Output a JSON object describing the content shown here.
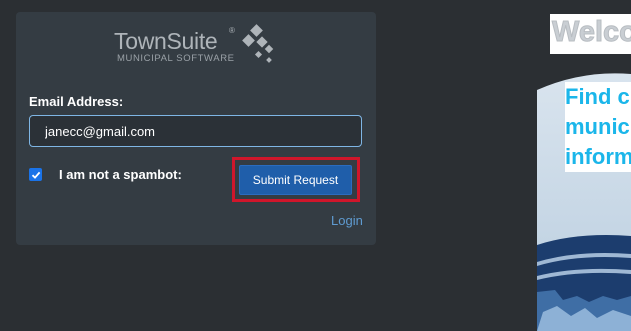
{
  "brand": {
    "name": "TownSuite",
    "registered": "®",
    "tagline": "MUNICIPAL SOFTWARE"
  },
  "form": {
    "email_label": "Email Address:",
    "email_value": "janecc@gmail.com",
    "spambot_checked": true,
    "spambot_label": "I am not a spambot:",
    "submit_label": "Submit Request",
    "login_label": "Login"
  },
  "hero": {
    "welcome": "Welco",
    "find_lines": [
      "Find c",
      "munic",
      "inform"
    ]
  },
  "colors": {
    "background": "#2b2f33",
    "card": "#343c43",
    "accent_button": "#1f5eaa",
    "highlight_box": "#d0162b",
    "link": "#5f9bd1",
    "hero_text": "#1bb6ea"
  }
}
